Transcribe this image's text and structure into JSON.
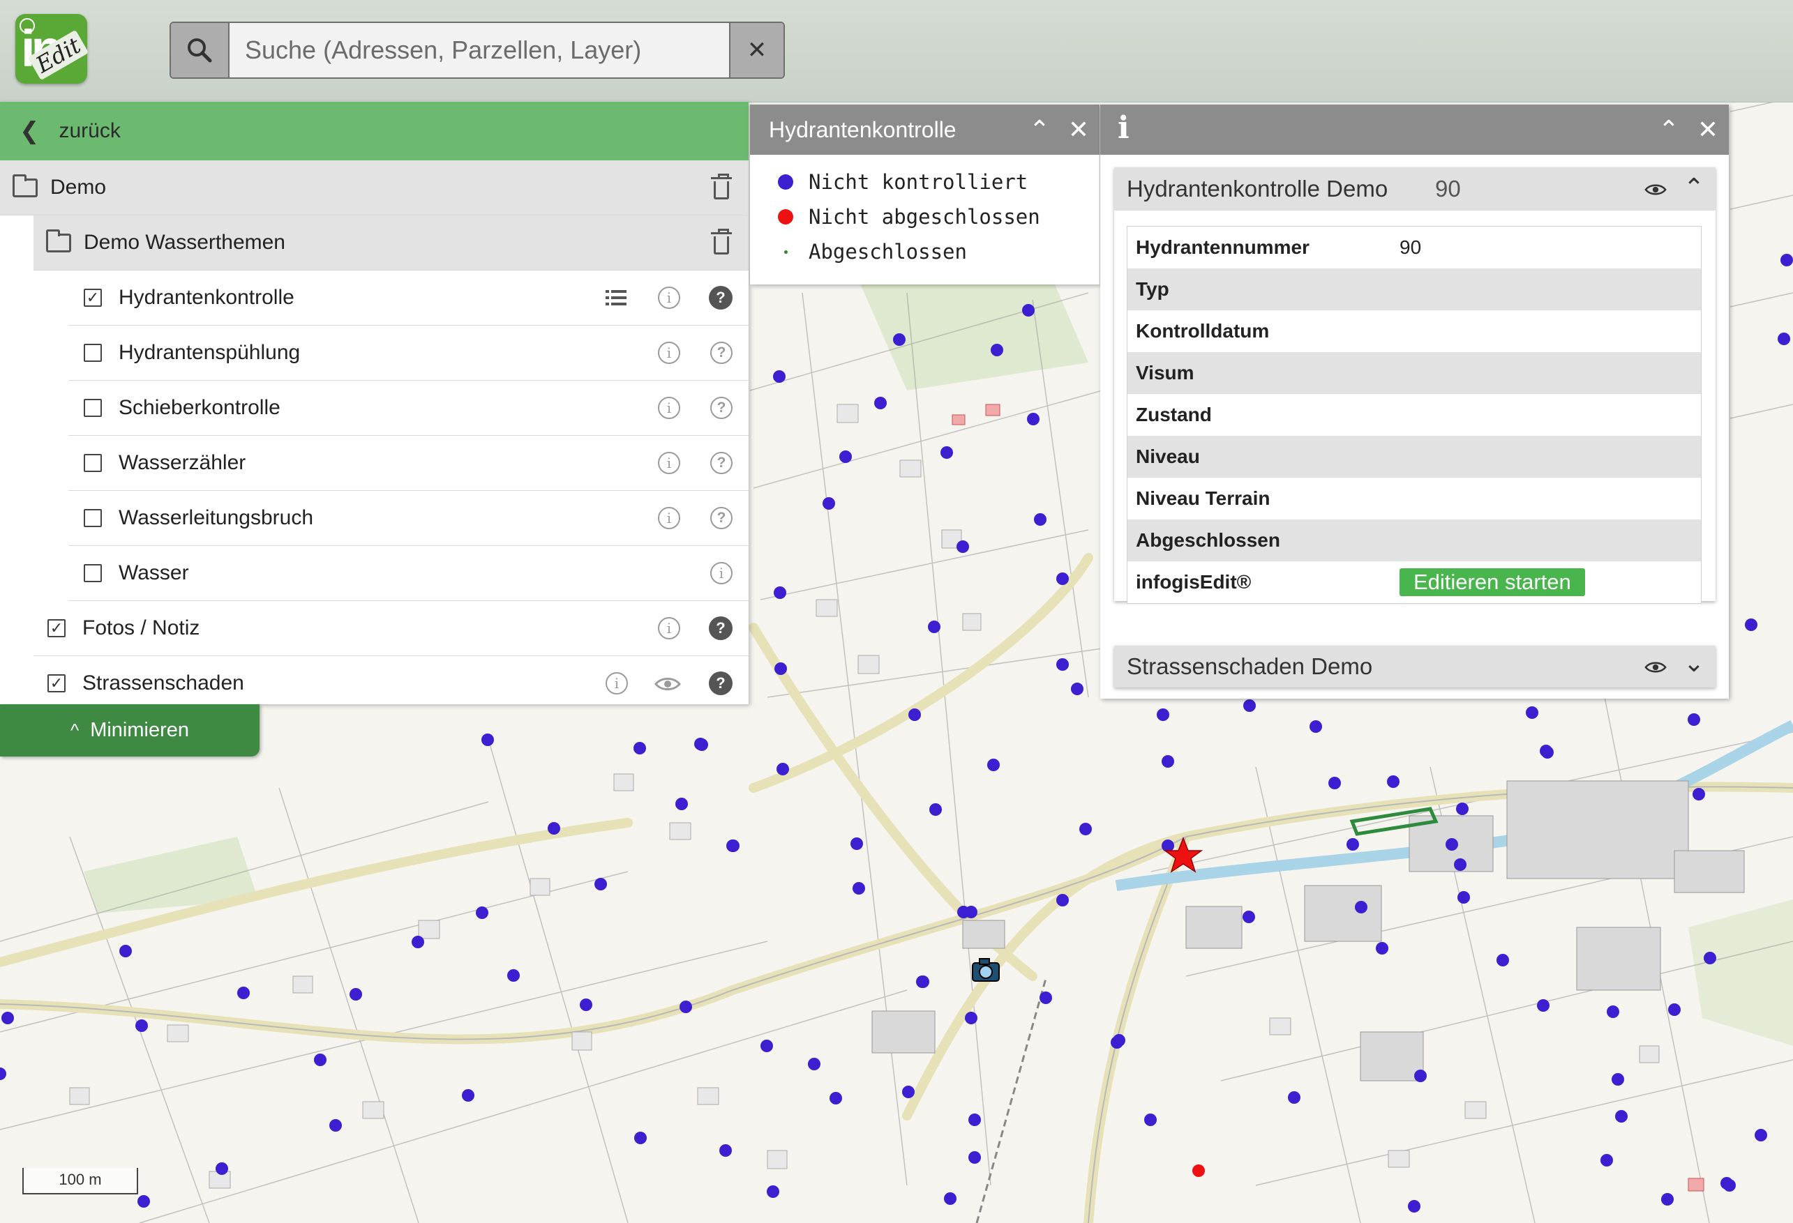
{
  "header": {
    "logo_text": "in",
    "logo_edit": "Edit",
    "search_placeholder": "Suche (Adressen, Parzellen, Layer)"
  },
  "layer_panel": {
    "back_label": "zurück",
    "minimize_label": "Minimieren",
    "groups": [
      {
        "label": "Demo"
      },
      {
        "label": "Demo Wasserthemen"
      }
    ],
    "layers": [
      {
        "label": "Hydrantenkontrolle",
        "checked": true
      },
      {
        "label": "Hydrantenspühlung",
        "checked": false
      },
      {
        "label": "Schieberkontrolle",
        "checked": false
      },
      {
        "label": "Wasserzähler",
        "checked": false
      },
      {
        "label": "Wasserleitungsbruch",
        "checked": false
      },
      {
        "label": "Wasser",
        "checked": false
      },
      {
        "label": "Fotos / Notiz",
        "checked": true
      },
      {
        "label": "Strassenschaden",
        "checked": true
      }
    ]
  },
  "legend": {
    "title": "Hydrantenkontrolle",
    "items": [
      {
        "label": "Nicht kontrolliert",
        "color": "#3b1fd1"
      },
      {
        "label": "Nicht abgeschlossen",
        "color": "#ee1111"
      },
      {
        "label": "Abgeschlossen",
        "color": "#2a8a2a"
      }
    ]
  },
  "info_panel": {
    "feature_title": "Hydrantenkontrolle Demo",
    "feature_id": "90",
    "attributes": [
      {
        "key": "Hydrantennummer",
        "value": "90"
      },
      {
        "key": "Typ",
        "value": ""
      },
      {
        "key": "Kontrolldatum",
        "value": ""
      },
      {
        "key": "Visum",
        "value": ""
      },
      {
        "key": "Zustand",
        "value": ""
      },
      {
        "key": "Niveau",
        "value": ""
      },
      {
        "key": "Niveau Terrain",
        "value": ""
      },
      {
        "key": "Abgeschlossen",
        "value": ""
      },
      {
        "key": "infogisEdit®",
        "value": ""
      }
    ],
    "edit_button_label": "Editieren starten",
    "second_card_title": "Strassenschaden Demo"
  },
  "map": {
    "scale_label": "100 m",
    "colors": {
      "hydrant": "#3b1fd1",
      "selected_star": "#ee1111",
      "river": "#a9d3e6"
    }
  }
}
